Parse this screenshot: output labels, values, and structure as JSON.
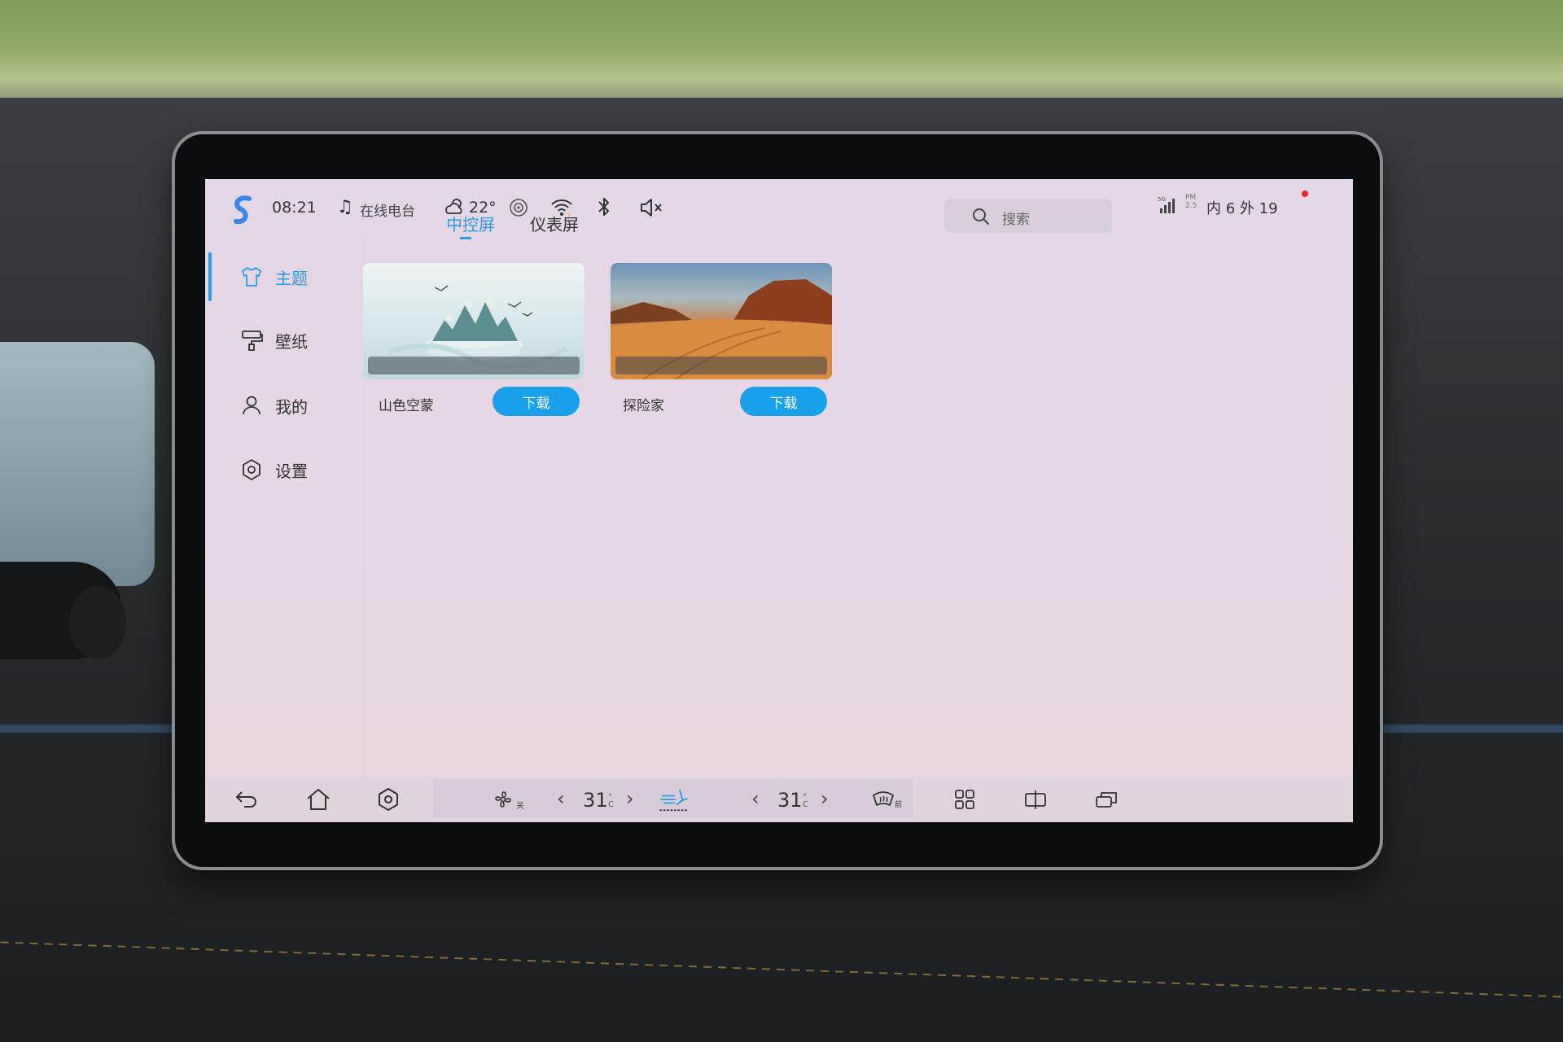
{
  "status_bar": {
    "time": "08:21",
    "music_label": "在线电台",
    "temperature": "22°",
    "network": "5G",
    "pm_label": "PM",
    "pm_value": "2.5",
    "in_label": "内",
    "in_value": "6",
    "out_label": "外",
    "out_value": "19"
  },
  "sidebar": {
    "items": [
      {
        "label": "主题",
        "icon": "tshirt-icon",
        "active": true
      },
      {
        "label": "壁纸",
        "icon": "paint-roller-icon",
        "active": false
      },
      {
        "label": "我的",
        "icon": "person-icon",
        "active": false
      },
      {
        "label": "设置",
        "icon": "hexagon-gear-icon",
        "active": false
      }
    ]
  },
  "tabs": [
    {
      "label": "中控屏",
      "active": true
    },
    {
      "label": "仪表屏",
      "active": false
    }
  ],
  "search": {
    "placeholder": "搜索"
  },
  "themes": [
    {
      "name": "山色空蒙",
      "button": "下载"
    },
    {
      "name": "探险家",
      "button": "下载"
    }
  ],
  "dock": {
    "fan_state": "关",
    "driver_temp": "31",
    "passenger_temp": "31",
    "temp_unit_top": "°",
    "temp_unit_bottom": "C",
    "defrost_label": "前"
  },
  "colors": {
    "accent": "#2b9be3",
    "download_button": "#1aa0ea",
    "screen_background": "#e4d6e4",
    "notification_dot": "#e8262e"
  }
}
